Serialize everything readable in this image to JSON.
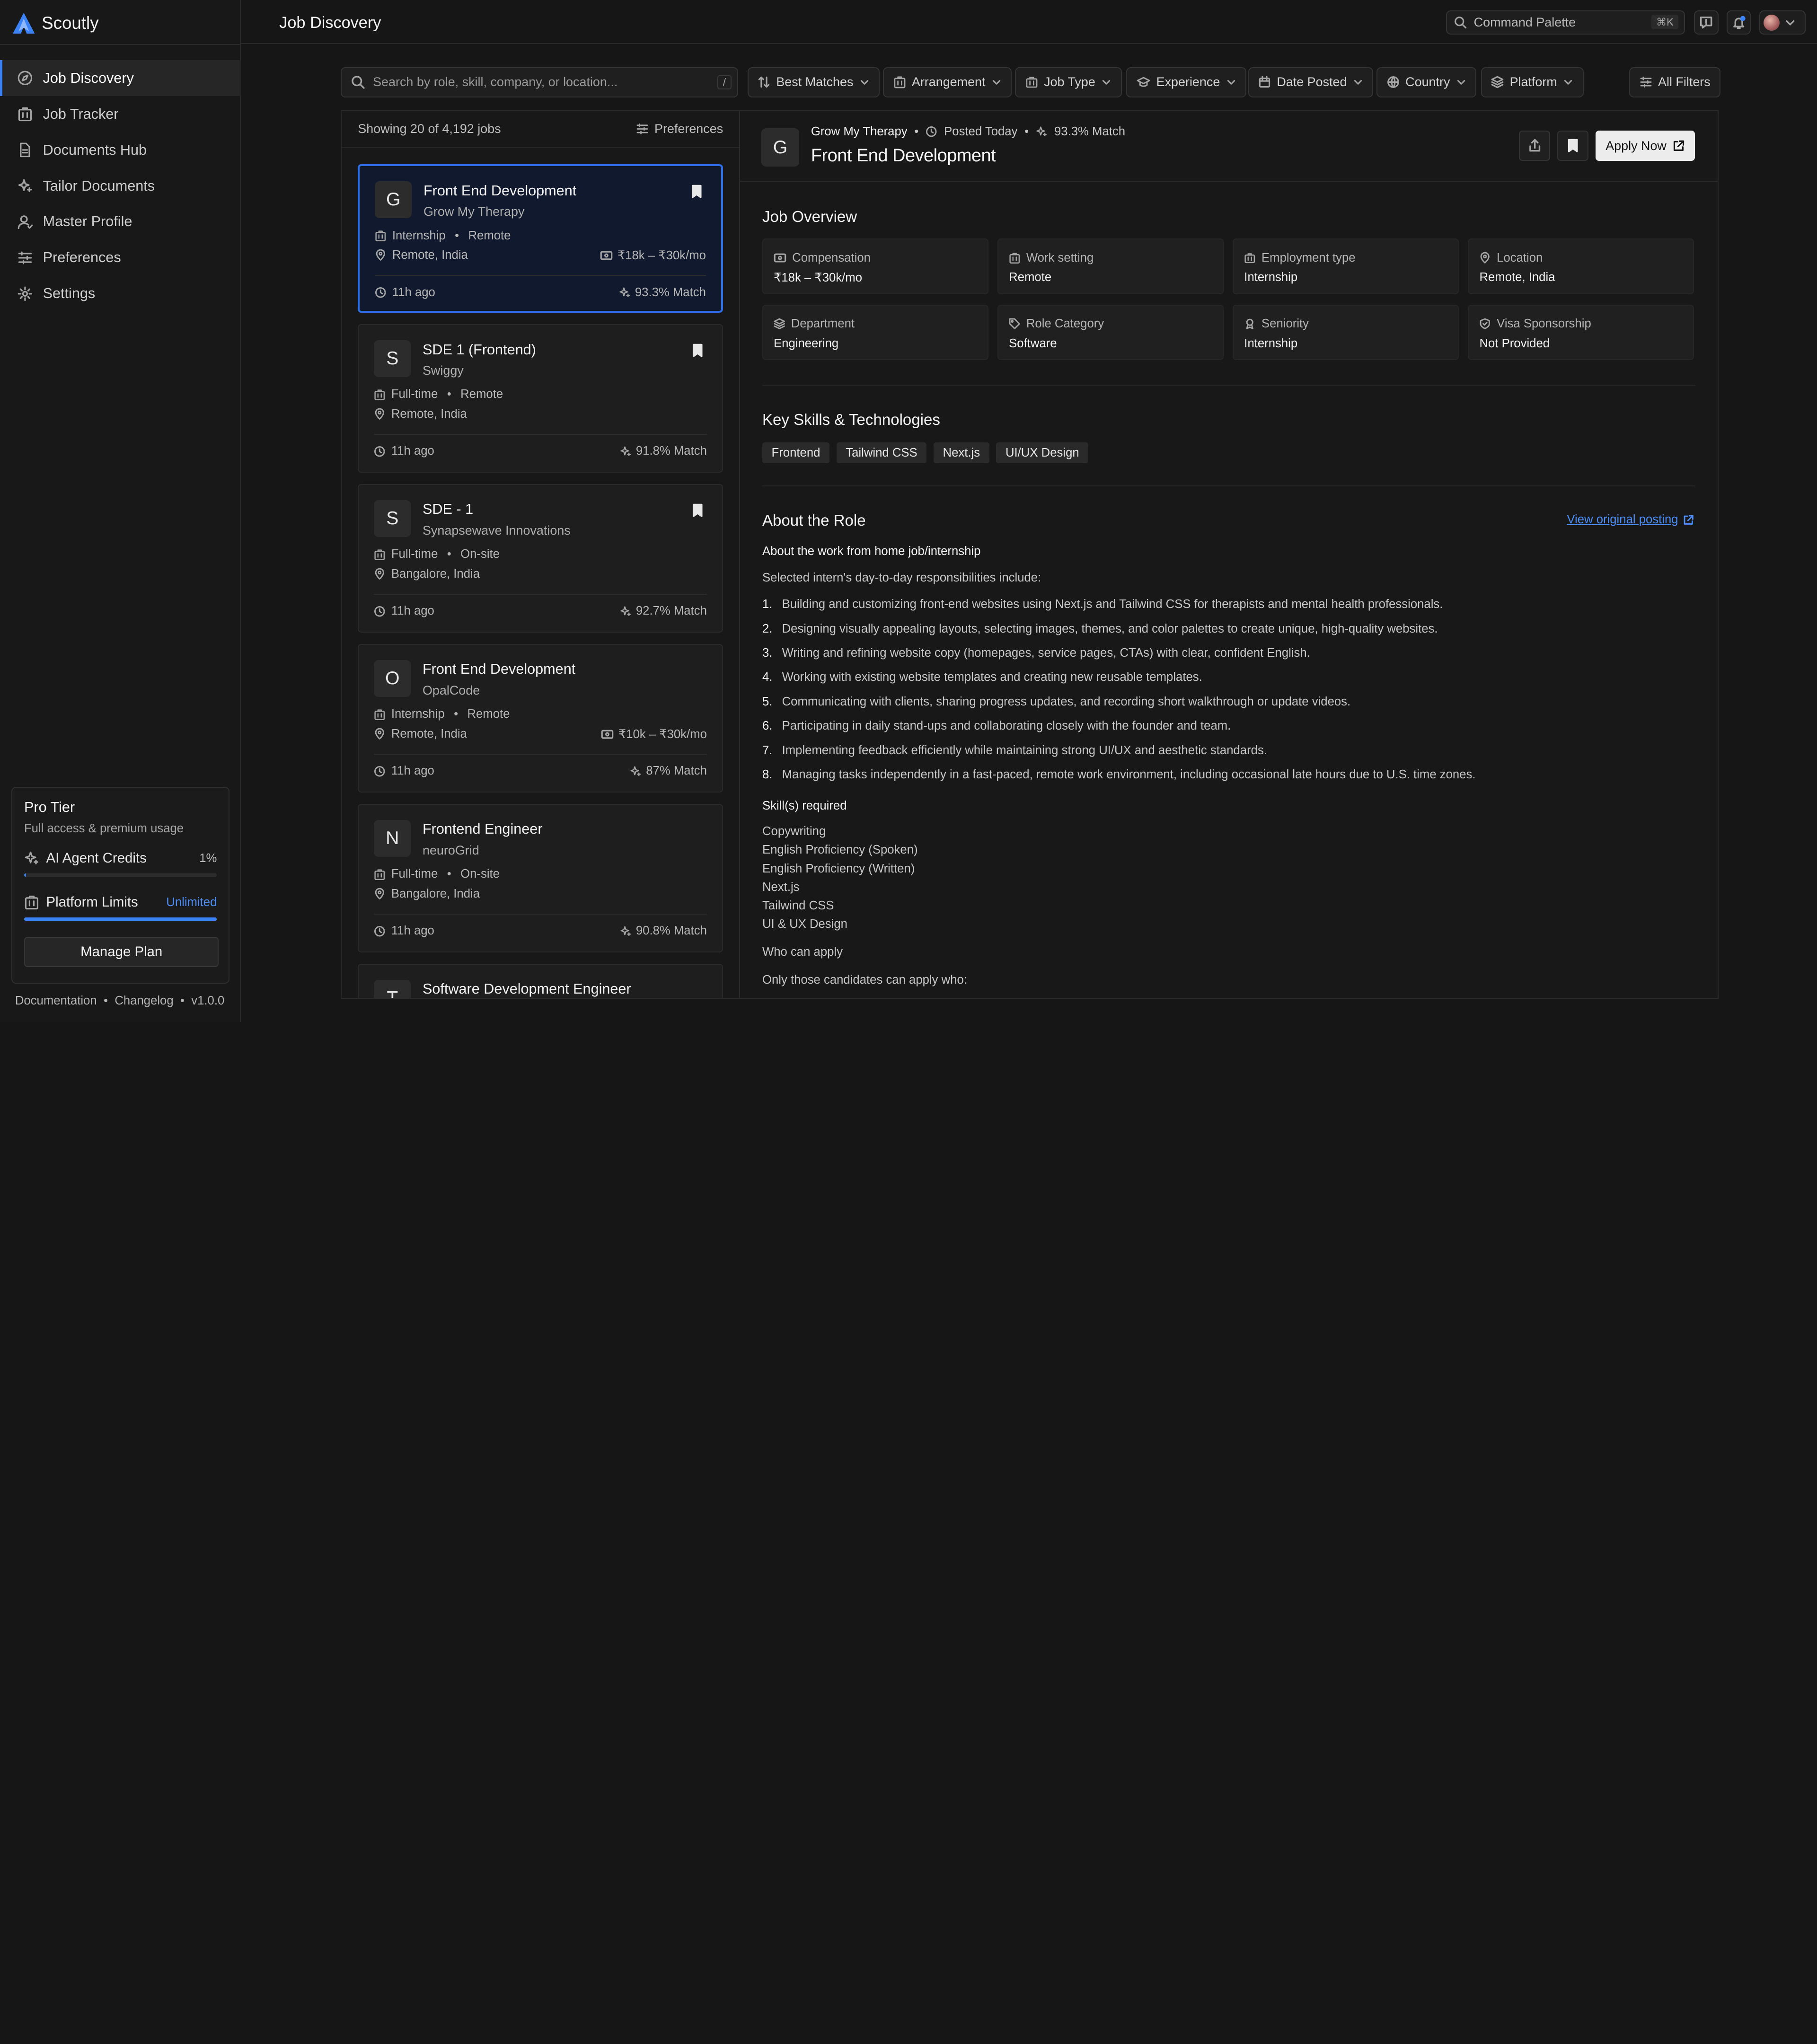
{
  "app": {
    "name": "Scoutly"
  },
  "sidebar": {
    "items": [
      {
        "label": "Job Discovery",
        "icon": "compass-icon",
        "active": true
      },
      {
        "label": "Job Tracker",
        "icon": "building-icon"
      },
      {
        "label": "Documents Hub",
        "icon": "document-icon"
      },
      {
        "label": "Tailor Documents",
        "icon": "sparkles-icon"
      },
      {
        "label": "Master Profile",
        "icon": "user-icon"
      },
      {
        "label": "Preferences",
        "icon": "sliders-icon"
      },
      {
        "label": "Settings",
        "icon": "gear-icon"
      }
    ],
    "plan": {
      "title": "Pro Tier",
      "subtitle": "Full access & premium usage",
      "credits_label": "AI Agent Credits",
      "credits_value": "1%",
      "credits_fraction": 0.01,
      "limits_label": "Platform Limits",
      "limits_value": "Unlimited",
      "limits_fraction": 1.0,
      "manage_label": "Manage Plan"
    },
    "footer": {
      "docs": "Documentation",
      "changelog": "Changelog",
      "version": "v1.0.0",
      "sep": "•"
    }
  },
  "header": {
    "title": "Job Discovery",
    "command_palette": "Command Palette",
    "shortcut": "⌘K"
  },
  "filters": {
    "search_placeholder": "Search by role, skill, company, or location...",
    "search_shortcut": "/",
    "buttons": [
      "Best Matches",
      "Arrangement",
      "Job Type",
      "Experience",
      "Date Posted",
      "Country",
      "Platform"
    ],
    "all_filters": "All Filters"
  },
  "list": {
    "count": "Showing 20 of 4,192 jobs",
    "preferences": "Preferences",
    "jobs": [
      {
        "letter": "G",
        "title": "Front End Development",
        "company": "Grow My Therapy",
        "type": "Internship",
        "arrangement": "Remote",
        "location": "Remote, India",
        "salary": "₹18k – ₹30k/mo",
        "ago": "11h ago",
        "match": "93.3% Match",
        "bookmarked": true
      },
      {
        "letter": "S",
        "title": "SDE 1 (Frontend)",
        "company": "Swiggy",
        "type": "Full-time",
        "arrangement": "Remote",
        "location": "Remote, India",
        "salary": "",
        "ago": "11h ago",
        "match": "91.8% Match",
        "bookmarked": true
      },
      {
        "letter": "S",
        "title": "SDE - 1",
        "company": "Synapsewave Innovations",
        "type": "Full-time",
        "arrangement": "On-site",
        "location": "Bangalore, India",
        "salary": "",
        "ago": "11h ago",
        "match": "92.7% Match",
        "bookmarked": true
      },
      {
        "letter": "O",
        "title": "Front End Development",
        "company": "OpalCode",
        "type": "Internship",
        "arrangement": "Remote",
        "location": "Remote, India",
        "salary": "₹10k – ₹30k/mo",
        "ago": "11h ago",
        "match": "87% Match",
        "bookmarked": false
      },
      {
        "letter": "N",
        "title": "Frontend Engineer",
        "company": "neuroGrid",
        "type": "Full-time",
        "arrangement": "On-site",
        "location": "Bangalore, India",
        "salary": "",
        "ago": "11h ago",
        "match": "90.8% Match",
        "bookmarked": false
      },
      {
        "letter": "T",
        "title": "Software Development Engineer",
        "company": "",
        "type": "",
        "arrangement": "",
        "location": "",
        "salary": "",
        "ago": "",
        "match": "",
        "bookmarked": false
      }
    ]
  },
  "detail": {
    "letter": "G",
    "company": "Grow My Therapy",
    "posted": "Posted Today",
    "match": "93.3% Match",
    "title": "Front End Development",
    "apply": "Apply Now",
    "overview_title": "Job Overview",
    "overview": [
      {
        "label": "Compensation",
        "value": "₹18k – ₹30k/mo",
        "icon": "banknote-icon"
      },
      {
        "label": "Work setting",
        "value": "Remote",
        "icon": "building-icon"
      },
      {
        "label": "Employment type",
        "value": "Internship",
        "icon": "briefcase-icon"
      },
      {
        "label": "Location",
        "value": "Remote, India",
        "icon": "pin-icon"
      },
      {
        "label": "Department",
        "value": "Engineering",
        "icon": "layers-icon"
      },
      {
        "label": "Role Category",
        "value": "Software",
        "icon": "tag-icon"
      },
      {
        "label": "Seniority",
        "value": "Internship",
        "icon": "badge-icon"
      },
      {
        "label": "Visa Sponsorship",
        "value": "Not Provided",
        "icon": "shield-icon"
      }
    ],
    "skills_title": "Key Skills & Technologies",
    "skills": [
      "Frontend",
      "Tailwind CSS",
      "Next.js",
      "UI/UX Design"
    ],
    "about_title": "About the Role",
    "view_original": "View original posting",
    "about_sub": "About the work from home job/internship",
    "about_intro": "Selected intern's day-to-day responsibilities include:",
    "responsibilities": [
      "Building and customizing front-end websites using Next.js and Tailwind CSS for therapists and mental health professionals.",
      "Designing visually appealing layouts, selecting images, themes, and color palettes to create unique, high-quality websites.",
      "Writing and refining website copy (homepages, service pages, CTAs) with clear, confident English.",
      "Working with existing website templates and creating new reusable templates.",
      "Communicating with clients, sharing progress updates, and recording short walkthrough or update videos.",
      "Participating in daily stand-ups and collaborating closely with the founder and team.",
      "Implementing feedback efficiently while maintaining strong UI/UX and aesthetic standards.",
      "Managing tasks independently in a fast-paced, remote work environment, including occasional late hours due to U.S. time zones."
    ],
    "skills_req_title": "Skill(s) required",
    "skills_req": [
      "Copywriting",
      "English Proficiency (Spoken)",
      "English Proficiency (Written)",
      "Next.js",
      "Tailwind CSS",
      "UI & UX Design"
    ],
    "who_title": "Who can apply",
    "who_text": "Only those candidates can apply who:"
  },
  "colors": {
    "accent": "#3b82f6",
    "bg": "#161616",
    "selected_border": "#2f6fe6"
  }
}
